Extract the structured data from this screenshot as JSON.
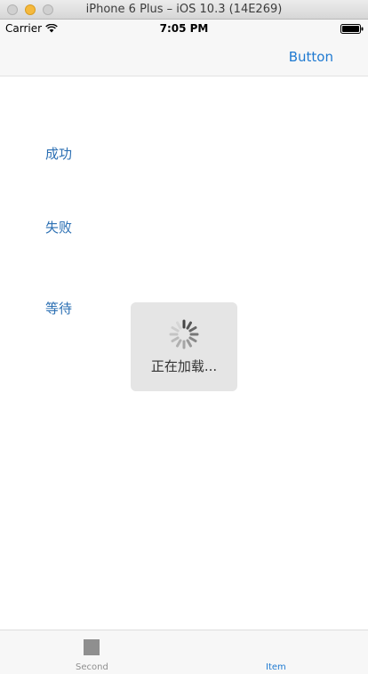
{
  "window": {
    "title": "iPhone 6 Plus – iOS 10.3 (14E269)"
  },
  "status_bar": {
    "carrier": "Carrier",
    "time": "7:05 PM",
    "wifi_icon": "wifi-icon",
    "battery_icon": "battery-icon"
  },
  "nav_bar": {
    "right_button_label": "Button"
  },
  "content": {
    "links": [
      {
        "label": "成功"
      },
      {
        "label": "失败"
      },
      {
        "label": "等待"
      }
    ]
  },
  "hud": {
    "text": "正在加载...",
    "icon": "spinner-icon"
  },
  "tab_bar": {
    "tabs": [
      {
        "label": "Second",
        "selected": false
      },
      {
        "label": "Item",
        "selected": true
      }
    ]
  },
  "colors": {
    "accent": "#1f7ad1",
    "link": "#2b6fb3",
    "hud_background": "#e5e5e5",
    "bar_background": "#f7f7f7",
    "inactive_tab": "#8f8f8f"
  }
}
